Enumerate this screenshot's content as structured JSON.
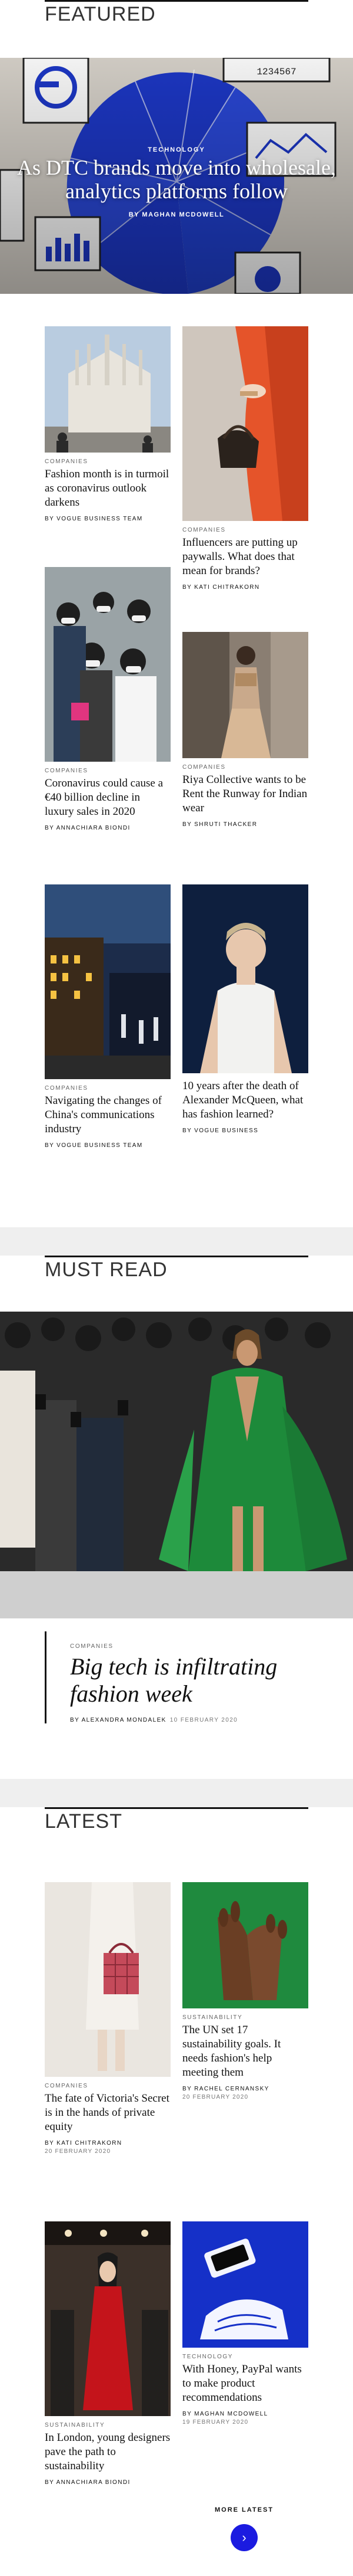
{
  "featured": {
    "heading": "FEATURED",
    "hero": {
      "category": "TECHNOLOGY",
      "title": "As DTC brands move into wholesale, analytics platforms follow",
      "byline": "BY MAGHAN MCDOWELL"
    },
    "articles": [
      {
        "category": "COMPANIES",
        "title": "Fashion month is in turmoil as coronavirus outlook darkens",
        "byline": "BY VOGUE BUSINESS TEAM"
      },
      {
        "category": "COMPANIES",
        "title": "Influencers are putting up paywalls. What does that mean for brands?",
        "byline": "BY KATI CHITRAKORN"
      },
      {
        "category": "COMPANIES",
        "title": "Coronavirus could cause a €40 billion decline in luxury sales in 2020",
        "byline": "BY ANNACHIARA BIONDI"
      },
      {
        "category": "COMPANIES",
        "title": "Riya Collective wants to be Rent the Runway for Indian wear",
        "byline": "BY SHRUTI THACKER"
      },
      {
        "category": "COMPANIES",
        "title": "Navigating the changes of China's communications industry",
        "byline": "BY VOGUE BUSINESS TEAM"
      },
      {
        "category": "",
        "title": "10 years after the death of Alexander McQueen, what has fashion learned?",
        "byline": "BY VOGUE BUSINESS"
      }
    ]
  },
  "must_read": {
    "heading": "MUST READ",
    "category": "COMPANIES",
    "title": "Big tech is infiltrating fashion week",
    "byline": "BY ALEXANDRA MONDALEK",
    "date": "10 FEBRUARY 2020"
  },
  "latest": {
    "heading": "LATEST",
    "articles": [
      {
        "category": "COMPANIES",
        "title": "The fate of Victoria's Secret is in the hands of private equity",
        "byline": "BY KATI CHITRAKORN",
        "date": "20 FEBRUARY 2020"
      },
      {
        "category": "SUSTAINABILITY",
        "title": "The UN set 17 sustainability goals. It needs fashion's help meeting them",
        "byline": "BY RACHEL CERNANSKY",
        "date": "20 FEBRUARY 2020"
      },
      {
        "category": "SUSTAINABILITY",
        "title": "In London, young designers pave the path to sustainability",
        "byline": "BY ANNACHIARA BIONDI",
        "date": ""
      },
      {
        "category": "TECHNOLOGY",
        "title": "With Honey, PayPal wants to make product recommendations",
        "byline": "BY MAGHAN MCDOWELL",
        "date": "19 FEBRUARY 2020"
      }
    ],
    "more_label": "MORE LATEST",
    "more_icon": "chevron-right-icon"
  },
  "hero_digits": "1234567"
}
